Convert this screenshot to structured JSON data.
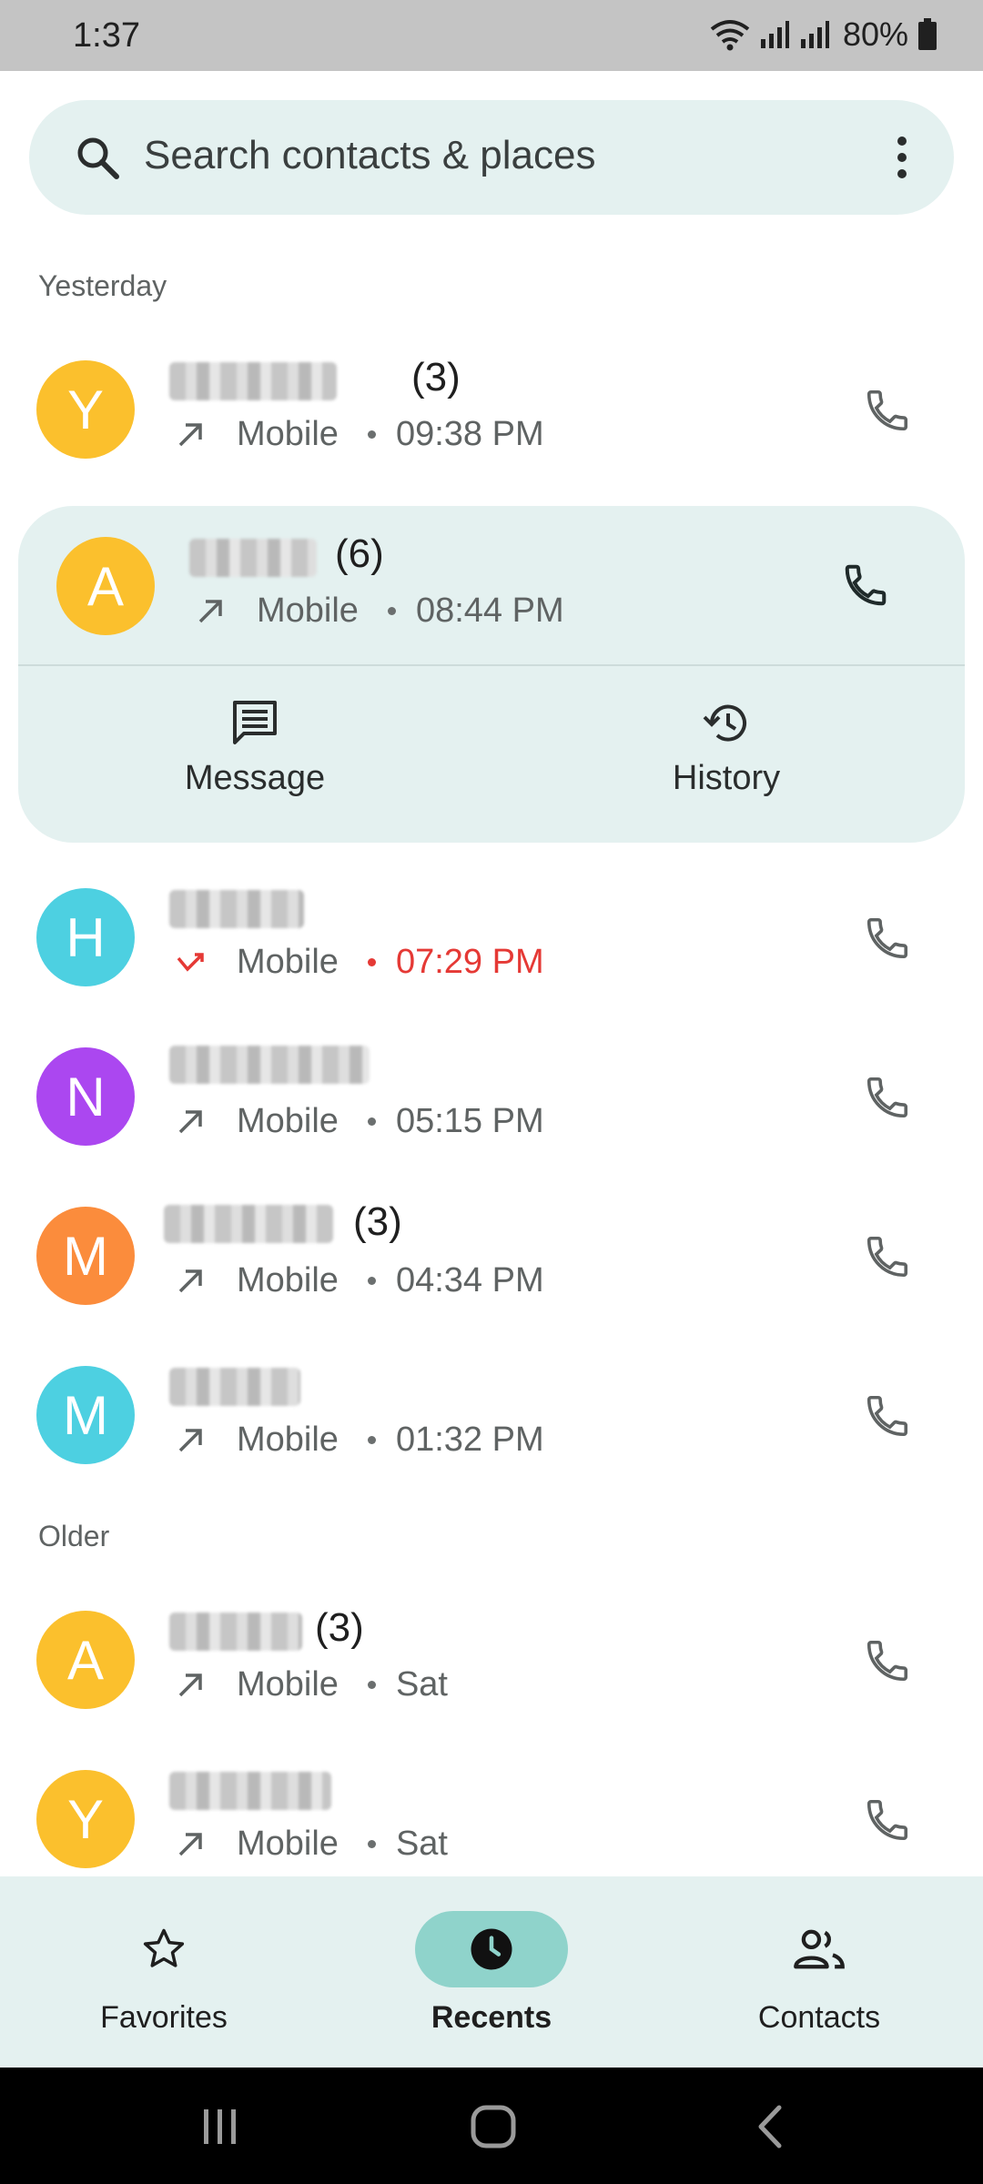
{
  "status_bar": {
    "time": "1:37",
    "battery": "80%"
  },
  "search": {
    "placeholder": "Search contacts & places"
  },
  "sections": {
    "yesterday": "Yesterday",
    "older": "Older"
  },
  "calls": [
    {
      "initial": "Y",
      "avatar_color": "#fbc02d",
      "count": "(3)",
      "type": "Mobile",
      "time": "09:38 PM",
      "direction": "outgoing"
    },
    {
      "initial": "A",
      "avatar_color": "#fbc02d",
      "count": "(6)",
      "type": "Mobile",
      "time": "08:44 PM",
      "direction": "outgoing",
      "expanded": true
    },
    {
      "initial": "H",
      "avatar_color": "#4dd0e1",
      "count": "",
      "type": "Mobile",
      "time": "07:29 PM",
      "direction": "missed"
    },
    {
      "initial": "N",
      "avatar_color": "#ab47f0",
      "count": "",
      "type": "Mobile",
      "time": "05:15 PM",
      "direction": "outgoing"
    },
    {
      "initial": "M",
      "avatar_color": "#fb8c3c",
      "count": "(3)",
      "type": "Mobile",
      "time": "04:34 PM",
      "direction": "outgoing"
    },
    {
      "initial": "M",
      "avatar_color": "#4dd0e1",
      "count": "",
      "type": "Mobile",
      "time": "01:32 PM",
      "direction": "outgoing"
    },
    {
      "initial": "A",
      "avatar_color": "#fbc02d",
      "count": "(3)",
      "type": "Mobile",
      "time": "Sat",
      "direction": "outgoing"
    },
    {
      "initial": "Y",
      "avatar_color": "#fbc02d",
      "count": "",
      "type": "Mobile",
      "time": "Sat",
      "direction": "outgoing"
    }
  ],
  "expanded_actions": {
    "message": "Message",
    "history": "History"
  },
  "bottom_nav": {
    "favorites": "Favorites",
    "recents": "Recents",
    "contacts": "Contacts",
    "active": "recents"
  },
  "colors": {
    "accent_bg": "#e4f1f0",
    "active_pill": "#8fd3cb",
    "missed": "#e53935"
  },
  "icons": [
    "search-icon",
    "more-vert-icon",
    "outgoing-call-icon",
    "missed-call-icon",
    "phone-icon",
    "message-icon",
    "history-icon",
    "star-icon",
    "clock-icon",
    "people-icon"
  ]
}
